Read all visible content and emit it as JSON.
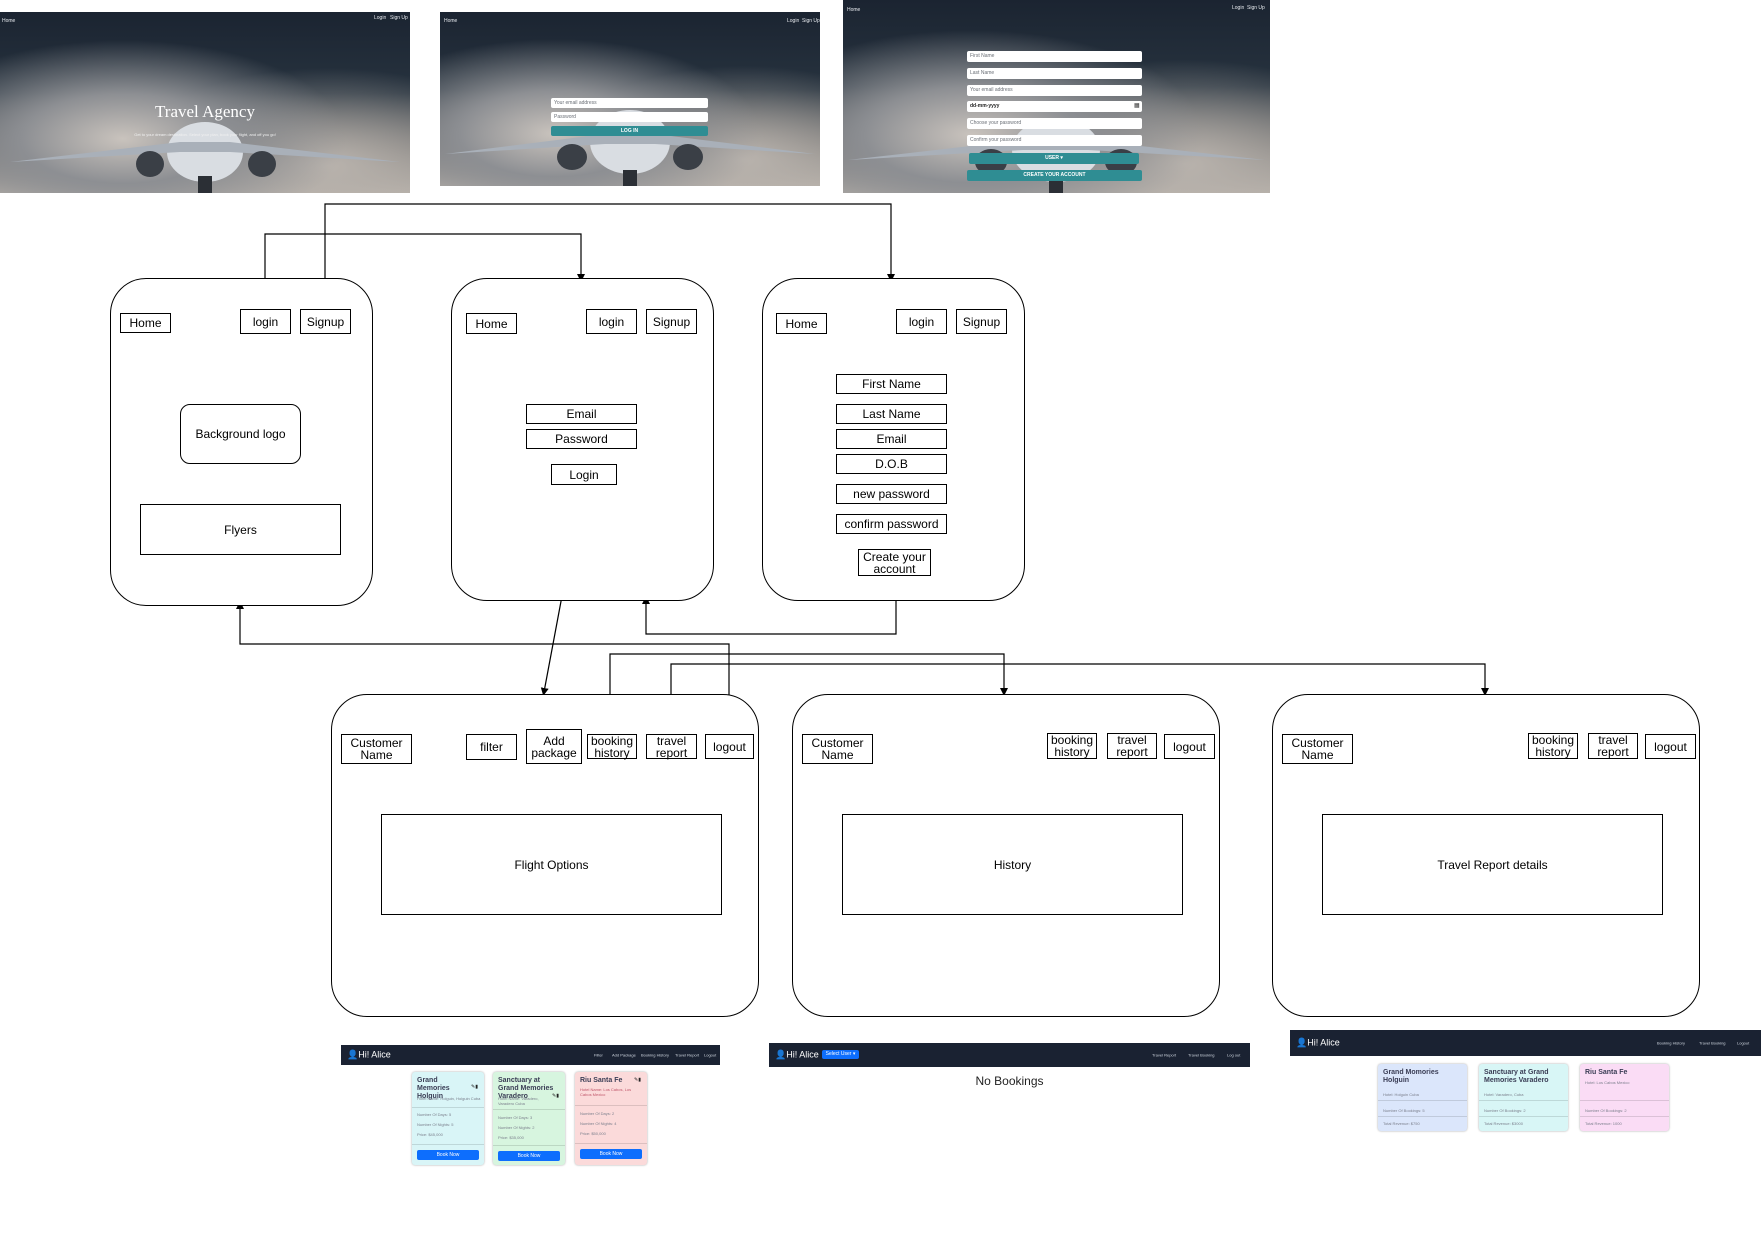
{
  "screens": {
    "home": {
      "nav_left": "Home",
      "nav_login": "Login",
      "nav_signup": "Sign Up",
      "title": "Travel Agency",
      "tagline": "Get to your dream destination. Select your plan, book your flight, and off you go!"
    },
    "login": {
      "nav_left": "Home",
      "nav_login": "Login",
      "nav_signup": "Sign Up",
      "email_placeholder": "Your email address",
      "password_placeholder": "Password",
      "button": "LOG IN"
    },
    "signup": {
      "nav_left": "Home",
      "nav_login": "Login",
      "nav_signup": "Sign Up",
      "first_name": "First Name",
      "last_name": "Last Name",
      "email": "Your email address",
      "dob": "dd-mm-yyyy",
      "password": "Choose your password",
      "confirm": "Confirm your password",
      "role": "USER",
      "button": "CREATE YOUR ACCOUNT"
    }
  },
  "wireframes": {
    "home": {
      "home": "Home",
      "login": "login",
      "signup": "Signup",
      "logo": "Background logo",
      "flyers": "Flyers"
    },
    "login": {
      "home": "Home",
      "login": "login",
      "signup": "Signup",
      "email": "Email",
      "password": "Password",
      "submit": "Login"
    },
    "signup": {
      "home": "Home",
      "login": "login",
      "signup": "Signup",
      "first_name": "First Name",
      "last_name": "Last Name",
      "email": "Email",
      "dob": "D.O.B",
      "new_password": "new password",
      "confirm_password": "confirm password",
      "create": "Create your account"
    },
    "dashboard": {
      "customer": "Customer Name",
      "filter": "filter",
      "add_package": "Add package",
      "booking_history": "booking history",
      "travel_report": "travel report",
      "logout": "logout",
      "content": "Flight Options"
    },
    "history": {
      "customer": "Customer Name",
      "booking_history": "booking history",
      "travel_report": "travel report",
      "logout": "logout",
      "content": "History"
    },
    "report": {
      "customer": "Customer Name",
      "booking_history": "booking history",
      "travel_report": "travel report",
      "logout": "logout",
      "content": "Travel Report details"
    }
  },
  "apps": {
    "dashboard": {
      "greeting": "Hi! Alice",
      "nav": [
        "Filter",
        "Add Package",
        "Booking History",
        "Travel Report",
        "Logout"
      ],
      "cards": [
        {
          "title": "Grand Memories Holguin",
          "subtitle": "Hotel Name: Holguin, Holguin Cuba",
          "lines": [
            "Number Of Days: 5",
            "Number Of Nights: 5",
            "Price: $45,000"
          ],
          "button": "Book Now",
          "bg": "#d9f5f7"
        },
        {
          "title": "Sanctuary at Grand Memories Varadero",
          "subtitle": "Hotel Name: Varadero, Varadero Cuba",
          "lines": [
            "Number Of Days: 3",
            "Number Of Nights: 2",
            "Price: $35,000"
          ],
          "button": "Book Now",
          "bg": "#d7f5df"
        },
        {
          "title": "Riu Santa Fe",
          "subtitle": "Hotel Name: Los Cabos, Los Cabos Mexico",
          "lines": [
            "Number Of Days: 2",
            "Number Of Nights: 4",
            "Price: $50,000"
          ],
          "button": "Book Now",
          "bg": "#fbdada"
        }
      ]
    },
    "history": {
      "greeting": "Hi! Alice",
      "select": "Select User",
      "nav": [
        "Travel Report",
        "Travel Booking",
        "Log out"
      ],
      "empty": "No Bookings"
    },
    "report": {
      "greeting": "Hi! Alice",
      "nav": [
        "Booking History",
        "Travel Booking",
        "Logout"
      ],
      "cards": [
        {
          "title": "Grand Momories Holguin",
          "subtitle": "Hotel: Holguin Cuba",
          "lines": [
            "Number Of Bookings: 5",
            "Total Revenue: $750"
          ],
          "bg": "#dbe6fb"
        },
        {
          "title": "Sanctuary at Grand Memories Varadero",
          "subtitle": "Hotel: Varadero, Cuba",
          "lines": [
            "Number Of Bookings: 2",
            "Total Revenue: $3000"
          ],
          "bg": "#d8f6f6"
        },
        {
          "title": "Riu Santa Fe",
          "subtitle": "Hotel: Los Cabos Mexico",
          "lines": [
            "Number Of Bookings: 2",
            "Total Revenue: 1000"
          ],
          "bg": "#fadcf5"
        }
      ]
    }
  },
  "colors": {
    "navbar": "#1a2232",
    "accent_button": "#2f8d93",
    "primary_button": "#0d6efd",
    "connector": "#000000"
  }
}
